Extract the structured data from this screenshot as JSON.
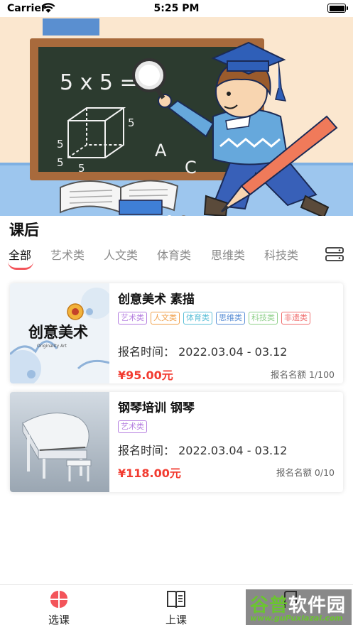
{
  "status_bar": {
    "carrier": "Carrier",
    "time": "5:25 PM"
  },
  "banner": {
    "board_text": "5 x 5 =",
    "cube_labels": [
      "5",
      "5",
      "5",
      "5",
      "A",
      "C"
    ],
    "slide_count": 2,
    "active_slide": 1
  },
  "section": {
    "title": "课后"
  },
  "category_tabs": [
    {
      "label": "全部",
      "active": true
    },
    {
      "label": "艺术类",
      "active": false
    },
    {
      "label": "人文类",
      "active": false
    },
    {
      "label": "体育类",
      "active": false
    },
    {
      "label": "思维类",
      "active": false
    },
    {
      "label": "科技类",
      "active": false
    }
  ],
  "courses": [
    {
      "title": "创意美术  素描",
      "thumb_text": "创意美术",
      "thumb_subtext": "Originality Art",
      "tags": [
        {
          "label": "艺术类",
          "color": "#b57fe0"
        },
        {
          "label": "人文类",
          "color": "#f0a04b"
        },
        {
          "label": "体育类",
          "color": "#5dc0d8"
        },
        {
          "label": "思维类",
          "color": "#5b8fd6"
        },
        {
          "label": "科技类",
          "color": "#8fd08a"
        },
        {
          "label": "非遗类",
          "color": "#f07070"
        }
      ],
      "reg_time": "报名时间：  2022.03.04 - 03.12",
      "price": "¥95.00元",
      "quota": "报名名额 1/100"
    },
    {
      "title": "钢琴培训  钢琴",
      "tags": [
        {
          "label": "艺术类",
          "color": "#b57fe0"
        }
      ],
      "reg_time": "报名时间：  2022.03.04 - 03.12",
      "price": "¥118.00元",
      "quota": "报名名额 0/10"
    }
  ],
  "bottom_tabs": [
    {
      "label": "选课",
      "icon": "course-select-icon",
      "active": true
    },
    {
      "label": "上课",
      "icon": "book-icon",
      "active": false
    },
    {
      "label": "",
      "icon": "profile-icon",
      "active": false
    }
  ],
  "watermark": {
    "main_a": "谷普",
    "main_b": "软件园",
    "sub": "www.guPuxiazai.com"
  },
  "colors": {
    "accent": "#f3545a",
    "price": "#f23b30",
    "tab_inactive": "#8a8a8a"
  }
}
